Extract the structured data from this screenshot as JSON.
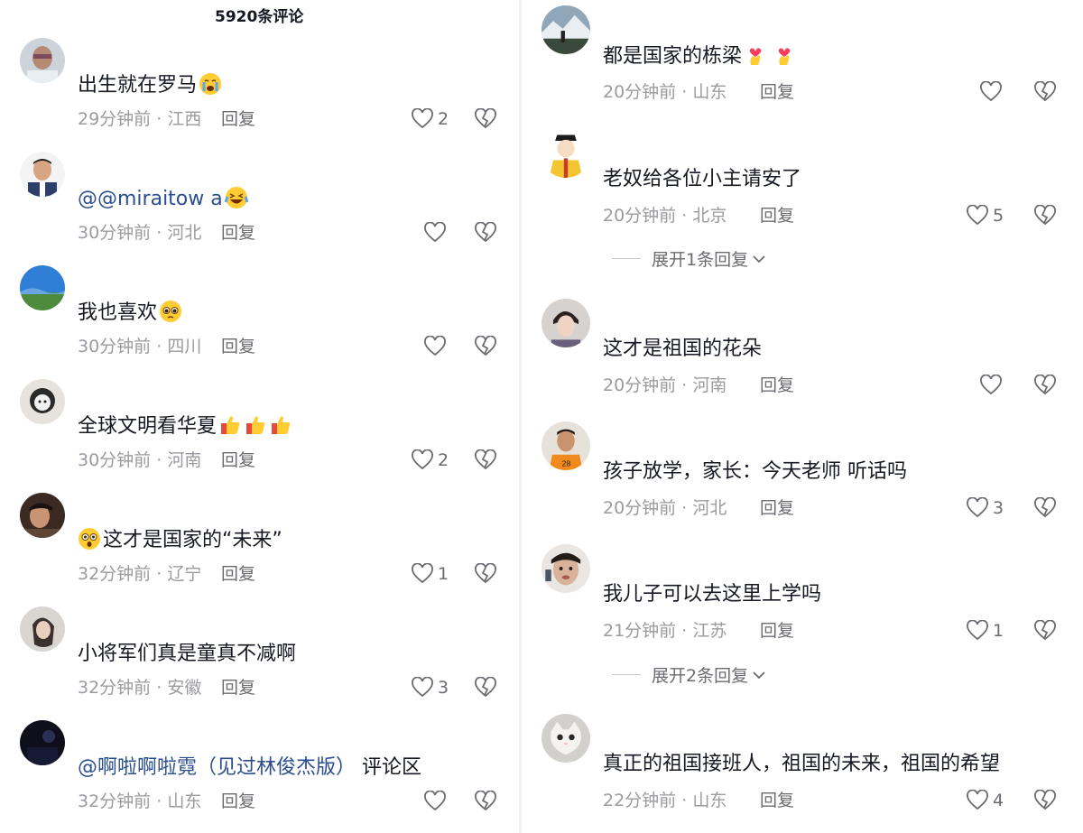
{
  "header": {
    "title": "5920条评论"
  },
  "left": [
    {
      "text": "出生就在罗马",
      "time": "29分钟前",
      "region": "江西",
      "reply": "回复",
      "likes": "2"
    },
    {
      "mention": "@@miraitow a",
      "time": "30分钟前",
      "region": "河北",
      "reply": "回复",
      "likes": ""
    },
    {
      "text": "我也喜欢",
      "time": "30分钟前",
      "region": "四川",
      "reply": "回复",
      "likes": ""
    },
    {
      "text": "全球文明看华夏",
      "time": "30分钟前",
      "region": "河南",
      "reply": "回复",
      "likes": "2"
    },
    {
      "text": "这才是国家的“未来”",
      "time": "32分钟前",
      "region": "辽宁",
      "reply": "回复",
      "likes": "1"
    },
    {
      "text": "小将军们真是童真不减啊",
      "time": "32分钟前",
      "region": "安徽",
      "reply": "回复",
      "likes": "3"
    },
    {
      "mention": "@啊啦啊啦霓（见过林俊杰版）",
      "text": " 评论区",
      "time": "32分钟前",
      "region": "山东",
      "reply": "回复",
      "likes": ""
    }
  ],
  "right": [
    {
      "text": "都是国家的栋梁",
      "time": "20分钟前",
      "region": "山东",
      "reply": "回复",
      "likes": ""
    },
    {
      "text": "老奴给各位小主请安了",
      "time": "20分钟前",
      "region": "北京",
      "reply": "回复",
      "likes": "5",
      "expand": "展开1条回复"
    },
    {
      "text": "这才是祖国的花朵",
      "time": "20分钟前",
      "region": "河南",
      "reply": "回复",
      "likes": ""
    },
    {
      "text": "孩子放学，家长：今天老师 听话吗",
      "time": "20分钟前",
      "region": "河北",
      "reply": "回复",
      "likes": "3"
    },
    {
      "text": "我儿子可以去这里上学吗",
      "time": "21分钟前",
      "region": "江苏",
      "reply": "回复",
      "likes": "1",
      "expand": "展开2条回复"
    },
    {
      "text": "真正的祖国接班人，祖国的未来，祖国的希望",
      "time": "22分钟前",
      "region": "山东",
      "reply": "回复",
      "likes": "4"
    }
  ],
  "meta_separator": " · ",
  "colors": {
    "text": "#161823",
    "meta": "#9a9ba0",
    "mention": "#2b4e8e",
    "divider": "#f1f1f2"
  }
}
